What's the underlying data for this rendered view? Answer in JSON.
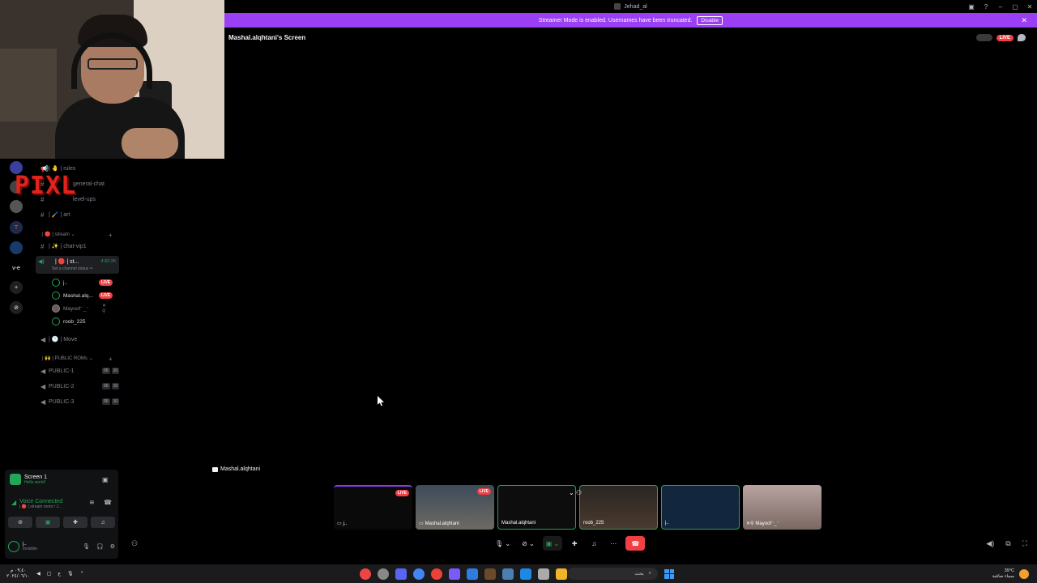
{
  "window": {
    "title": "Jehad_al",
    "controls": [
      "▣",
      "?",
      "–",
      "▢",
      "✕"
    ]
  },
  "banner": {
    "text": "Streamer Mode is enabled. Usernames have been truncated.",
    "disable_label": "Disable",
    "close": "✕"
  },
  "stream": {
    "title": "Mashal.alqhtani's Screen",
    "live": "LIVE",
    "name_tag": "Mashal.alqhtani"
  },
  "overlay": {
    "logo": "PIXL"
  },
  "servers": [
    "",
    "",
    "",
    "T",
    "",
    "v-e",
    "+",
    "⊘"
  ],
  "channels": [
    {
      "icon": "📢",
      "prefix": "| 🤚 |",
      "name": "rules"
    },
    {
      "icon": "#",
      "prefix": "",
      "name": "general-chat"
    },
    {
      "icon": "#",
      "prefix": "",
      "name": "level-ups"
    },
    {
      "icon": "#",
      "prefix": "| 🖌️ |",
      "name": "art"
    }
  ],
  "categories": {
    "stream": "| 🔴 | stream ⌄",
    "public": "| 🙌 | PUBLIC ROMs ⌄"
  },
  "chat_vip": {
    "prefix": "| ✨ |",
    "name": "chat-vip1"
  },
  "voice_channel": {
    "name": "| 🔴 | st...",
    "time": "4:52:26",
    "status": "Set a channel status ✏"
  },
  "members": [
    {
      "name": "j..",
      "live": "LIVE"
    },
    {
      "name": "Mashal.alq...",
      "live": "LIVE"
    },
    {
      "name": "Mayoof⁻_⁻",
      "live": ""
    },
    {
      "name": "roob_225",
      "live": ""
    }
  ],
  "move_channel": {
    "prefix": "| 🕐 |",
    "name": "Move"
  },
  "public_rooms": [
    {
      "name": "PUBLIC-1",
      "a": "00",
      "b": "10"
    },
    {
      "name": "PUBLIC-2",
      "a": "00",
      "b": "10"
    },
    {
      "name": "PUBLIC-3",
      "a": "00",
      "b": "10"
    }
  ],
  "panel": {
    "screen_title": "Screen 1",
    "screen_sub": "Hello world!",
    "vc_label": "Voice Connected",
    "vc_sub": "| 🔴 | stream room / J...",
    "user_name": "j..",
    "user_status": "Invisible"
  },
  "tiles": [
    {
      "label": "j..",
      "live": "LIVE",
      "speaking": false
    },
    {
      "label": "Mashal.alqhtani",
      "live": "LIVE",
      "speaking": false
    },
    {
      "label": "Mashal.alqhtani",
      "live": "",
      "speaking": true
    },
    {
      "label": "roob_225",
      "live": "",
      "speaking": true
    },
    {
      "label": "j..",
      "live": "",
      "speaking": true
    },
    {
      "label": "Mayoof⁻_⁻",
      "live": "",
      "speaking": false
    }
  ],
  "taskbar": {
    "left_time": "٠٩:٤٠ م",
    "left_date": "٢٠٢٤/٠٦/١٠",
    "search_text": "بحث",
    "temp": "39°C",
    "weather_text": "سماء صافية"
  },
  "colors": {
    "banner": "#9b3ff5",
    "live": "#f23f43",
    "speaking": "#23a55a",
    "logo": "#e2231a"
  }
}
